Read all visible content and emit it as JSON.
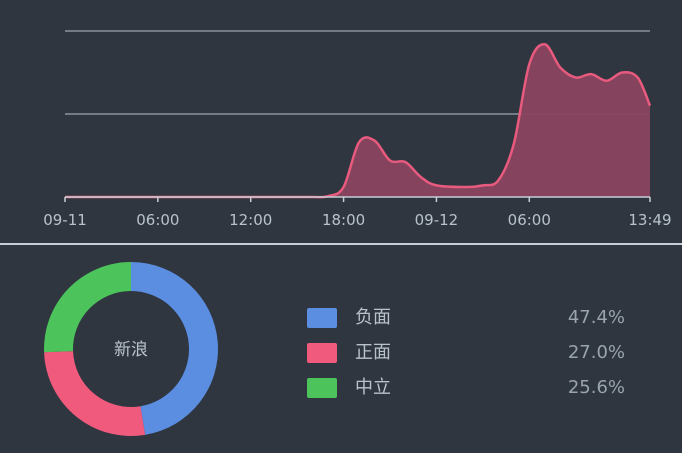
{
  "chart_data": [
    {
      "type": "area",
      "x_ticks": [
        "09-11",
        "06:00",
        "12:00",
        "18:00",
        "09-12",
        "06:00",
        "13:49"
      ],
      "x_hours": [
        0,
        2,
        6,
        10,
        12,
        14,
        15,
        16,
        17,
        18,
        19,
        20,
        21,
        22,
        23,
        24,
        26,
        27,
        28,
        29,
        30,
        31,
        32,
        33,
        34,
        35,
        36,
        37,
        37.8
      ],
      "values": [
        0,
        0,
        0,
        0,
        0,
        0,
        0,
        0,
        0.5,
        6,
        33,
        34,
        22,
        21,
        12,
        7,
        6,
        7,
        10,
        32,
        80,
        92,
        78,
        72,
        74,
        70,
        75,
        72,
        55
      ],
      "ylim": [
        0,
        100
      ],
      "gridlines": [
        50,
        100
      ],
      "color": "#e85a7e"
    },
    {
      "type": "pie",
      "donut": true,
      "center_label": "新浪",
      "slices": [
        {
          "label": "负面",
          "value": 47.4,
          "value_text": "47.4%",
          "color": "#5b8ee0"
        },
        {
          "label": "正面",
          "value": 27.0,
          "value_text": "27.0%",
          "color": "#ef5a7d"
        },
        {
          "label": "中立",
          "value": 25.6,
          "value_text": "25.6%",
          "color": "#4cc35b"
        }
      ]
    }
  ]
}
